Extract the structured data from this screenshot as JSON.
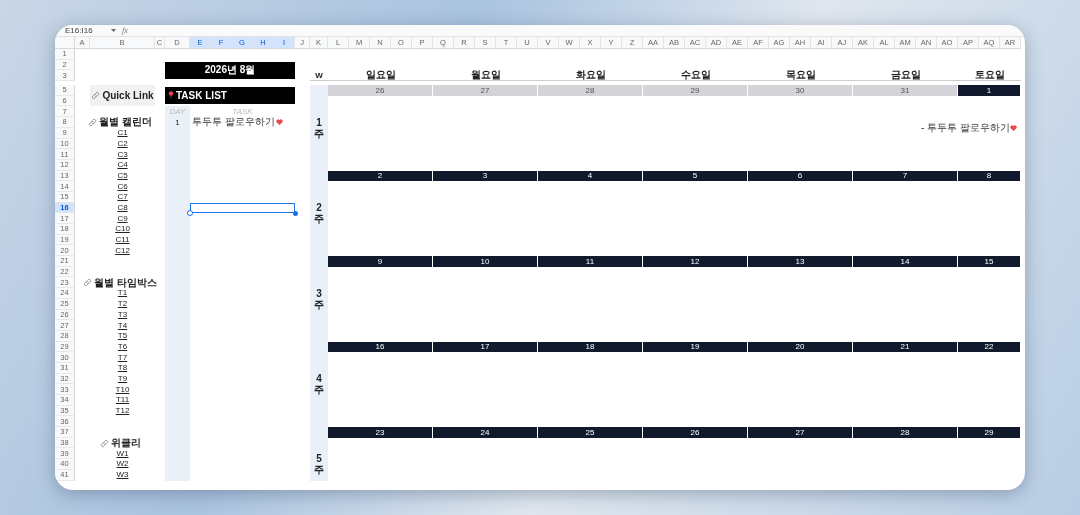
{
  "formula_bar": {
    "name_box": "E16:I16",
    "function_label": "fx"
  },
  "columns": [
    {
      "label": "A",
      "selected": false
    },
    {
      "label": "B",
      "selected": false
    },
    {
      "label": "C",
      "selected": false
    },
    {
      "label": "D",
      "selected": false
    },
    {
      "label": "E",
      "selected": true
    },
    {
      "label": "F",
      "selected": true
    },
    {
      "label": "G",
      "selected": true
    },
    {
      "label": "H",
      "selected": true
    },
    {
      "label": "I",
      "selected": true
    },
    {
      "label": "J",
      "selected": false
    },
    {
      "label": "K",
      "selected": false
    },
    {
      "label": "L",
      "selected": false
    },
    {
      "label": "M",
      "selected": false
    },
    {
      "label": "N",
      "selected": false
    },
    {
      "label": "O",
      "selected": false
    },
    {
      "label": "P",
      "selected": false
    },
    {
      "label": "Q",
      "selected": false
    },
    {
      "label": "R",
      "selected": false
    },
    {
      "label": "S",
      "selected": false
    },
    {
      "label": "T",
      "selected": false
    },
    {
      "label": "U",
      "selected": false
    },
    {
      "label": "V",
      "selected": false
    },
    {
      "label": "W",
      "selected": false
    },
    {
      "label": "X",
      "selected": false
    },
    {
      "label": "Y",
      "selected": false
    },
    {
      "label": "Z",
      "selected": false
    },
    {
      "label": "AA",
      "selected": false
    },
    {
      "label": "AB",
      "selected": false
    },
    {
      "label": "AC",
      "selected": false
    },
    {
      "label": "AD",
      "selected": false
    },
    {
      "label": "AE",
      "selected": false
    },
    {
      "label": "AF",
      "selected": false
    },
    {
      "label": "AG",
      "selected": false
    },
    {
      "label": "AH",
      "selected": false
    },
    {
      "label": "AI",
      "selected": false
    },
    {
      "label": "AJ",
      "selected": false
    },
    {
      "label": "AK",
      "selected": false
    },
    {
      "label": "AL",
      "selected": false
    },
    {
      "label": "AM",
      "selected": false
    },
    {
      "label": "AN",
      "selected": false
    },
    {
      "label": "AO",
      "selected": false
    },
    {
      "label": "AP",
      "selected": false
    },
    {
      "label": "AQ",
      "selected": false
    },
    {
      "label": "AR",
      "selected": false
    }
  ],
  "rows": [
    {
      "label": "1",
      "selected": false
    },
    {
      "label": "2",
      "selected": false
    },
    {
      "label": "3",
      "selected": false
    },
    {
      "label": "5",
      "selected": false
    },
    {
      "label": "6",
      "selected": false
    },
    {
      "label": "7",
      "selected": false
    },
    {
      "label": "8",
      "selected": false
    },
    {
      "label": "9",
      "selected": false
    },
    {
      "label": "10",
      "selected": false
    },
    {
      "label": "11",
      "selected": false
    },
    {
      "label": "12",
      "selected": false
    },
    {
      "label": "13",
      "selected": false
    },
    {
      "label": "14",
      "selected": false
    },
    {
      "label": "15",
      "selected": false
    },
    {
      "label": "16",
      "selected": true
    },
    {
      "label": "17",
      "selected": false
    },
    {
      "label": "18",
      "selected": false
    },
    {
      "label": "19",
      "selected": false
    },
    {
      "label": "20",
      "selected": false
    },
    {
      "label": "21",
      "selected": false
    },
    {
      "label": "22",
      "selected": false
    },
    {
      "label": "23",
      "selected": false
    },
    {
      "label": "24",
      "selected": false
    },
    {
      "label": "25",
      "selected": false
    },
    {
      "label": "26",
      "selected": false
    },
    {
      "label": "27",
      "selected": false
    },
    {
      "label": "28",
      "selected": false
    },
    {
      "label": "29",
      "selected": false
    },
    {
      "label": "30",
      "selected": false
    },
    {
      "label": "31",
      "selected": false
    },
    {
      "label": "32",
      "selected": false
    },
    {
      "label": "33",
      "selected": false
    },
    {
      "label": "34",
      "selected": false
    },
    {
      "label": "35",
      "selected": false
    },
    {
      "label": "36",
      "selected": false
    },
    {
      "label": "37",
      "selected": false
    },
    {
      "label": "38",
      "selected": false
    },
    {
      "label": "39",
      "selected": false
    },
    {
      "label": "40",
      "selected": false
    },
    {
      "label": "41",
      "selected": false
    }
  ],
  "quick_links": {
    "title": "Quick Link",
    "groups": [
      {
        "title": "월별 캘린더",
        "links": [
          "C1",
          "C2",
          "C3",
          "C4",
          "C5",
          "C6",
          "C7",
          "C8",
          "C9",
          "C10",
          "C11",
          "C12"
        ]
      },
      {
        "title": "월별 타임박스",
        "links": [
          "T1",
          "T2",
          "T3",
          "T4",
          "T5",
          "T6",
          "T7",
          "T8",
          "T9",
          "T10",
          "T11",
          "T12"
        ]
      },
      {
        "title": "위클리",
        "links": [
          "W1",
          "W2",
          "W3"
        ]
      }
    ]
  },
  "task_panel": {
    "month_title": "2026년 8월",
    "list_title": "TASK LIST",
    "day_heading": "DAY",
    "task_heading": "TASK",
    "tasks": [
      {
        "day": "1",
        "task": "투두투 팔로우하기"
      }
    ]
  },
  "calendar": {
    "week_heading": "W",
    "weekdays": [
      "일요일",
      "월요일",
      "화요일",
      "수요일",
      "목요일",
      "금요일",
      "토요일"
    ],
    "weeks": [
      {
        "number": "1",
        "unit": "주",
        "days": [
          {
            "date": "26",
            "in_month": false
          },
          {
            "date": "27",
            "in_month": false
          },
          {
            "date": "28",
            "in_month": false
          },
          {
            "date": "29",
            "in_month": false
          },
          {
            "date": "30",
            "in_month": false
          },
          {
            "date": "31",
            "in_month": false
          },
          {
            "date": "1",
            "in_month": true,
            "events": [
              "- 투두투 팔로우하기"
            ]
          }
        ]
      },
      {
        "number": "2",
        "unit": "주",
        "days": [
          {
            "date": "2",
            "in_month": true
          },
          {
            "date": "3",
            "in_month": true
          },
          {
            "date": "4",
            "in_month": true
          },
          {
            "date": "5",
            "in_month": true
          },
          {
            "date": "6",
            "in_month": true
          },
          {
            "date": "7",
            "in_month": true
          },
          {
            "date": "8",
            "in_month": true
          }
        ]
      },
      {
        "number": "3",
        "unit": "주",
        "days": [
          {
            "date": "9",
            "in_month": true
          },
          {
            "date": "10",
            "in_month": true
          },
          {
            "date": "11",
            "in_month": true
          },
          {
            "date": "12",
            "in_month": true
          },
          {
            "date": "13",
            "in_month": true
          },
          {
            "date": "14",
            "in_month": true
          },
          {
            "date": "15",
            "in_month": true
          }
        ]
      },
      {
        "number": "4",
        "unit": "주",
        "days": [
          {
            "date": "16",
            "in_month": true
          },
          {
            "date": "17",
            "in_month": true
          },
          {
            "date": "18",
            "in_month": true
          },
          {
            "date": "19",
            "in_month": true
          },
          {
            "date": "20",
            "in_month": true
          },
          {
            "date": "21",
            "in_month": true
          },
          {
            "date": "22",
            "in_month": true
          }
        ]
      },
      {
        "number": "5",
        "unit": "주",
        "days": [
          {
            "date": "23",
            "in_month": true
          },
          {
            "date": "24",
            "in_month": true
          },
          {
            "date": "25",
            "in_month": true
          },
          {
            "date": "26",
            "in_month": true
          },
          {
            "date": "27",
            "in_month": true
          },
          {
            "date": "28",
            "in_month": true
          },
          {
            "date": "29",
            "in_month": true
          }
        ]
      }
    ]
  }
}
